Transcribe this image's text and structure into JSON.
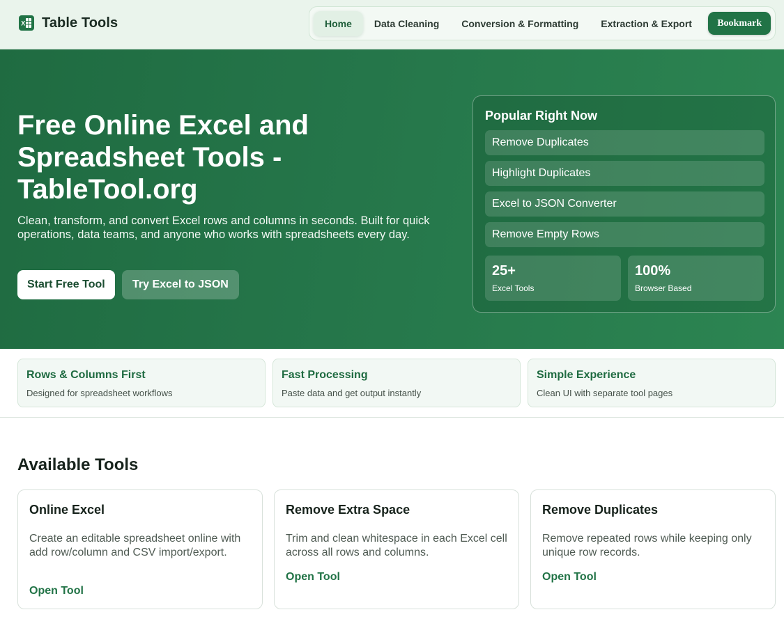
{
  "brand": {
    "name": "Table Tools",
    "icon": "excel-icon"
  },
  "nav": {
    "items": [
      "Home",
      "Data Cleaning",
      "Conversion & Formatting",
      "Extraction & Export"
    ],
    "active": "Home",
    "bookmark_label": "Bookmark"
  },
  "hero": {
    "title": "Free Online Excel and Spreadsheet Tools - TableTool.org",
    "subtitle": "Clean, transform, and convert Excel rows and columns in seconds. Built for quick operations, data teams, and anyone who works with spreadsheets every day.",
    "primary_button": "Start Free Tool",
    "secondary_button": "Try Excel to JSON"
  },
  "popular": {
    "title": "Popular Right Now",
    "items": [
      "Remove Duplicates",
      "Highlight Duplicates",
      "Excel to JSON Converter",
      "Remove Empty Rows"
    ],
    "stats": [
      {
        "value": "25+",
        "label": "Excel Tools"
      },
      {
        "value": "100%",
        "label": "Browser Based"
      }
    ]
  },
  "features": [
    {
      "title": "Rows & Columns First",
      "desc": "Designed for spreadsheet workflows"
    },
    {
      "title": "Fast Processing",
      "desc": "Paste data and get output instantly"
    },
    {
      "title": "Simple Experience",
      "desc": "Clean UI with separate tool pages"
    }
  ],
  "tools": {
    "section_title": "Available Tools",
    "cards": [
      {
        "title": "Online Excel",
        "desc": "Create an editable spreadsheet online with add row/column and CSV import/export.",
        "link": "Open Tool"
      },
      {
        "title": "Remove Extra Space",
        "desc": "Trim and clean whitespace in each Excel cell across all rows and columns.",
        "link": "Open Tool"
      },
      {
        "title": "Remove Duplicates",
        "desc": "Remove repeated rows while keeping only unique row records.",
        "link": "Open Tool"
      }
    ]
  },
  "colors": {
    "brand_green": "#217346",
    "hero_green": "#25764a",
    "accent_text": "#1f6b41"
  }
}
